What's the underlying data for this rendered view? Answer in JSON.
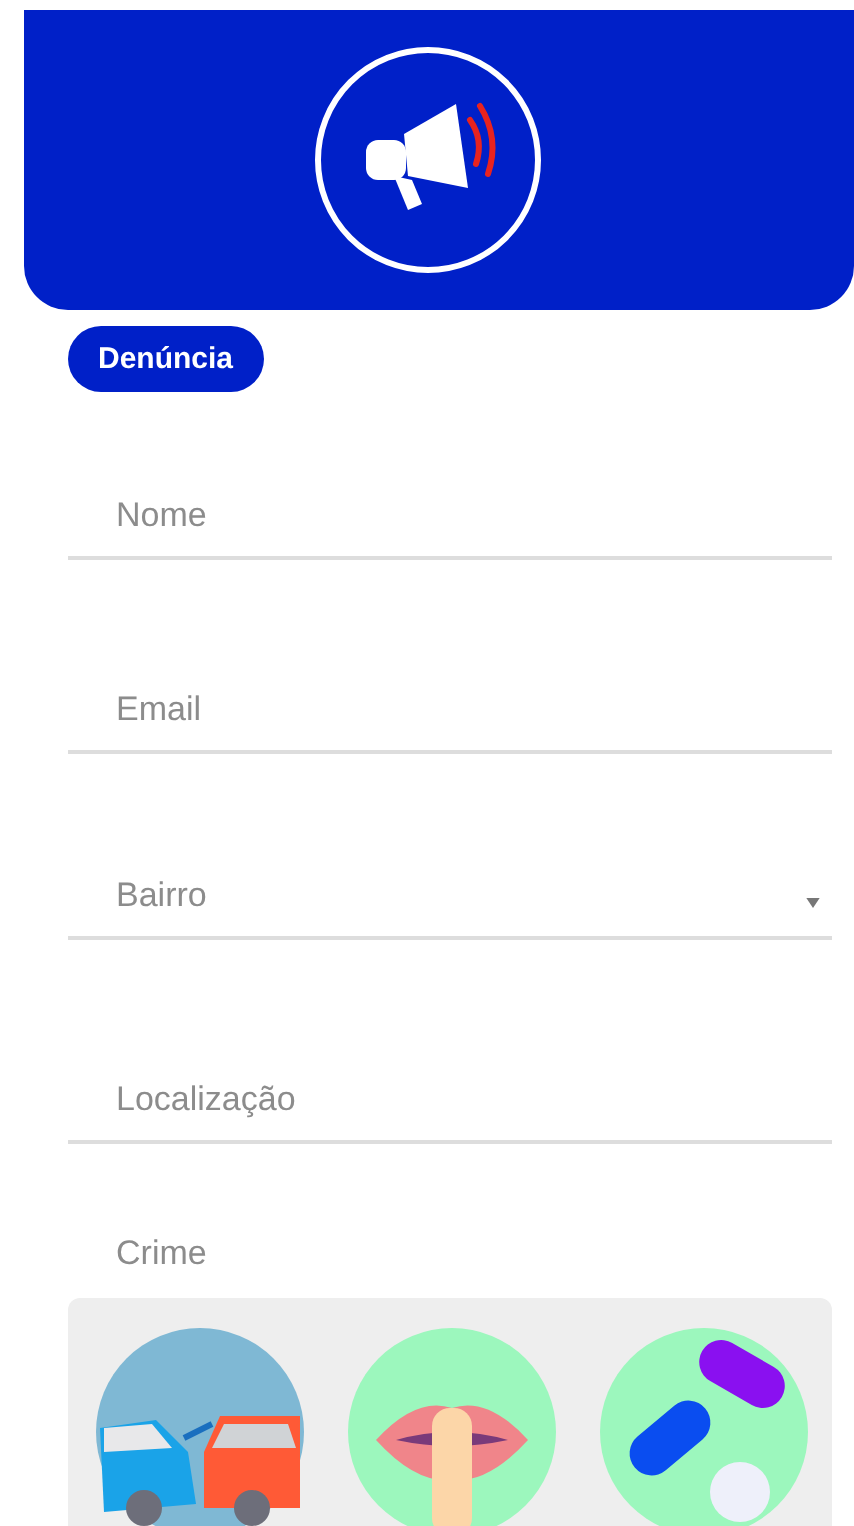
{
  "header": {
    "badge": "Denúncia"
  },
  "fields": [
    {
      "kind": "text",
      "placeholder": "Nome"
    },
    {
      "kind": "text",
      "placeholder": "Email"
    },
    {
      "kind": "select",
      "placeholder": "Bairro"
    },
    {
      "kind": "text",
      "placeholder": "Localização"
    }
  ],
  "crime": {
    "label": "Crime",
    "options": [
      {
        "kind": "accident"
      },
      {
        "kind": "silence"
      },
      {
        "kind": "drugs"
      }
    ]
  }
}
